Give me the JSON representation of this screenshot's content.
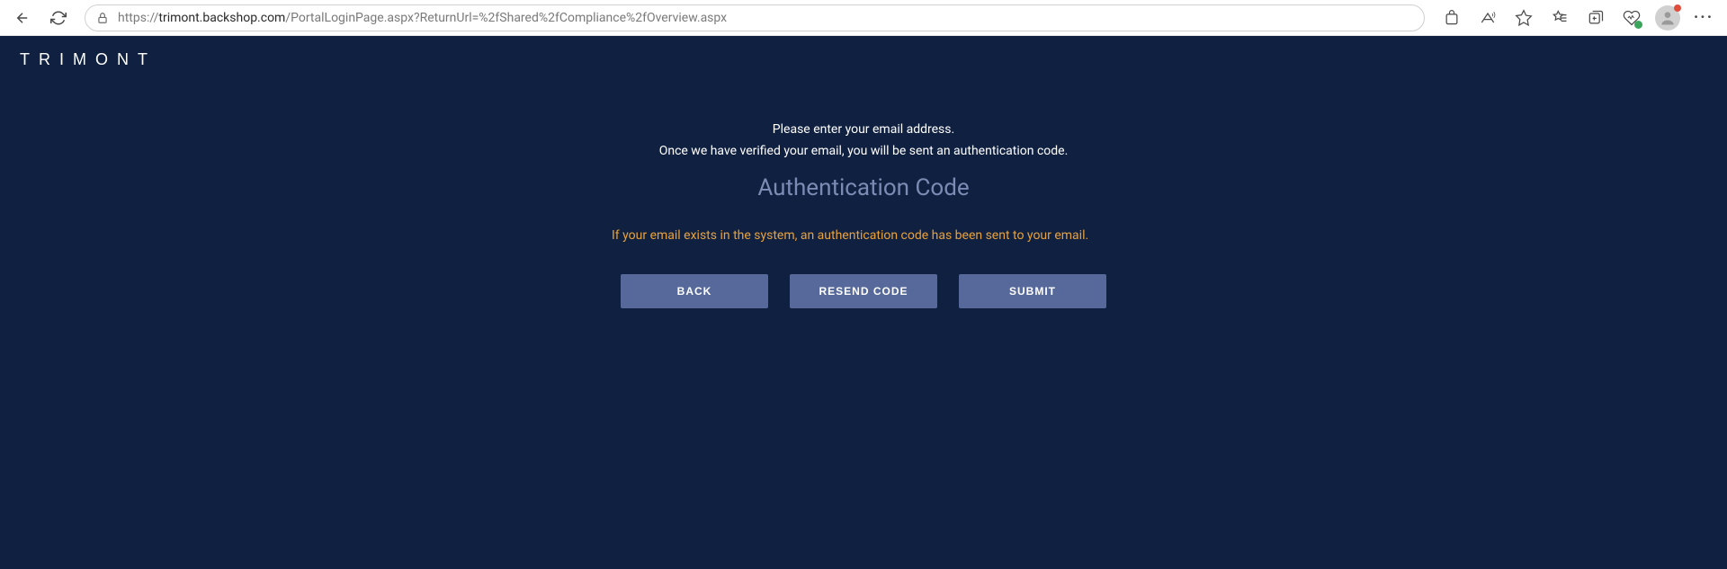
{
  "browser": {
    "url_prefix": "https://",
    "url_domain": "trimont.backshop.com",
    "url_path": "/PortalLoginPage.aspx?ReturnUrl=%2fShared%2fCompliance%2fOverview.aspx"
  },
  "page": {
    "logo_text": "TRIMONT",
    "instruction_line1": "Please enter your email address.",
    "instruction_line2": "Once we have verified your email, you will be sent an authentication code.",
    "heading": "Authentication Code",
    "info_message": "If your email exists in the system, an authentication code has been sent to your email.",
    "buttons": {
      "back": "BACK",
      "resend": "RESEND CODE",
      "submit": "SUBMIT"
    }
  }
}
